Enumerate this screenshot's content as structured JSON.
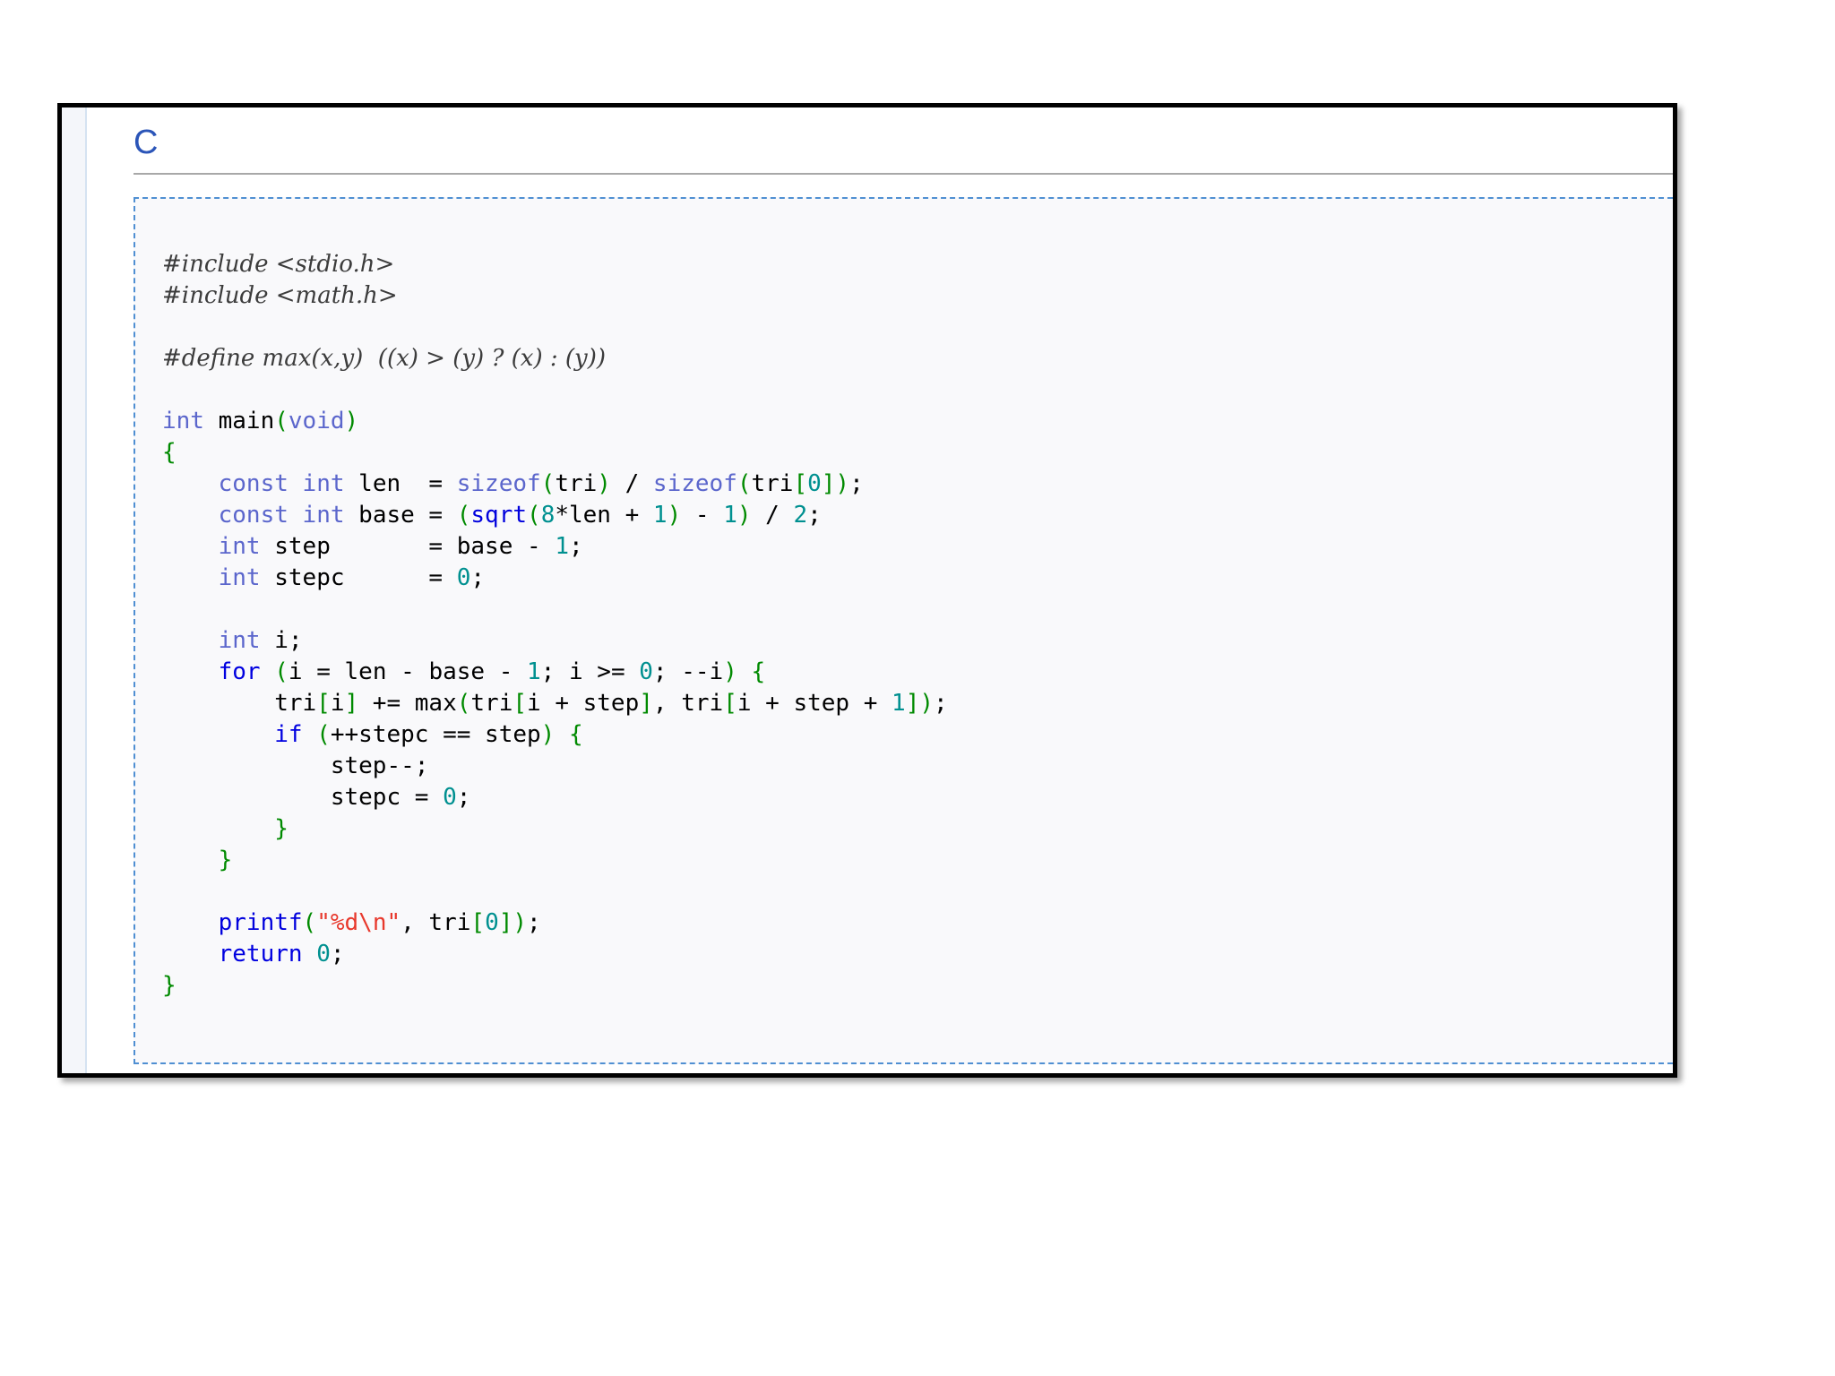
{
  "language_title": "C",
  "code_lines": [
    [
      {
        "t": "pre",
        "s": "#include <stdio.h>"
      }
    ],
    [
      {
        "t": "pre",
        "s": "#include <math.h>"
      }
    ],
    [],
    [
      {
        "t": "pre",
        "s": "#define max(x,y)  ((x) > (y) ? (x) : (y))"
      }
    ],
    [],
    [
      {
        "t": "kw",
        "s": "int"
      },
      {
        "t": "txt",
        "s": " main"
      },
      {
        "t": "br",
        "s": "("
      },
      {
        "t": "kw",
        "s": "void"
      },
      {
        "t": "br",
        "s": ")"
      }
    ],
    [
      {
        "t": "br",
        "s": "{"
      }
    ],
    [
      {
        "t": "txt",
        "s": "    "
      },
      {
        "t": "kw",
        "s": "const int"
      },
      {
        "t": "txt",
        "s": " len  = "
      },
      {
        "t": "kw",
        "s": "sizeof"
      },
      {
        "t": "br",
        "s": "("
      },
      {
        "t": "txt",
        "s": "tri"
      },
      {
        "t": "br",
        "s": ")"
      },
      {
        "t": "txt",
        "s": " / "
      },
      {
        "t": "kw",
        "s": "sizeof"
      },
      {
        "t": "br",
        "s": "("
      },
      {
        "t": "txt",
        "s": "tri"
      },
      {
        "t": "br",
        "s": "["
      },
      {
        "t": "num",
        "s": "0"
      },
      {
        "t": "br",
        "s": "])"
      },
      {
        "t": "txt",
        "s": ";"
      }
    ],
    [
      {
        "t": "txt",
        "s": "    "
      },
      {
        "t": "kw",
        "s": "const int"
      },
      {
        "t": "txt",
        "s": " base = "
      },
      {
        "t": "br",
        "s": "("
      },
      {
        "t": "fn",
        "s": "sqrt"
      },
      {
        "t": "br",
        "s": "("
      },
      {
        "t": "num",
        "s": "8"
      },
      {
        "t": "txt",
        "s": "*len + "
      },
      {
        "t": "num",
        "s": "1"
      },
      {
        "t": "br",
        "s": ")"
      },
      {
        "t": "txt",
        "s": " - "
      },
      {
        "t": "num",
        "s": "1"
      },
      {
        "t": "br",
        "s": ")"
      },
      {
        "t": "txt",
        "s": " / "
      },
      {
        "t": "num",
        "s": "2"
      },
      {
        "t": "txt",
        "s": ";"
      }
    ],
    [
      {
        "t": "txt",
        "s": "    "
      },
      {
        "t": "kw",
        "s": "int"
      },
      {
        "t": "txt",
        "s": " step       = base - "
      },
      {
        "t": "num",
        "s": "1"
      },
      {
        "t": "txt",
        "s": ";"
      }
    ],
    [
      {
        "t": "txt",
        "s": "    "
      },
      {
        "t": "kw",
        "s": "int"
      },
      {
        "t": "txt",
        "s": " stepc      = "
      },
      {
        "t": "num",
        "s": "0"
      },
      {
        "t": "txt",
        "s": ";"
      }
    ],
    [],
    [
      {
        "t": "txt",
        "s": "    "
      },
      {
        "t": "kw",
        "s": "int"
      },
      {
        "t": "txt",
        "s": " i;"
      }
    ],
    [
      {
        "t": "txt",
        "s": "    "
      },
      {
        "t": "kwb",
        "s": "for"
      },
      {
        "t": "txt",
        "s": " "
      },
      {
        "t": "br",
        "s": "("
      },
      {
        "t": "txt",
        "s": "i = len - base - "
      },
      {
        "t": "num",
        "s": "1"
      },
      {
        "t": "txt",
        "s": "; i >= "
      },
      {
        "t": "num",
        "s": "0"
      },
      {
        "t": "txt",
        "s": "; --i"
      },
      {
        "t": "br",
        "s": ")"
      },
      {
        "t": "txt",
        "s": " "
      },
      {
        "t": "br",
        "s": "{"
      }
    ],
    [
      {
        "t": "txt",
        "s": "        tri"
      },
      {
        "t": "br",
        "s": "["
      },
      {
        "t": "txt",
        "s": "i"
      },
      {
        "t": "br",
        "s": "]"
      },
      {
        "t": "txt",
        "s": " += max"
      },
      {
        "t": "br",
        "s": "("
      },
      {
        "t": "txt",
        "s": "tri"
      },
      {
        "t": "br",
        "s": "["
      },
      {
        "t": "txt",
        "s": "i + step"
      },
      {
        "t": "br",
        "s": "]"
      },
      {
        "t": "txt",
        "s": ", tri"
      },
      {
        "t": "br",
        "s": "["
      },
      {
        "t": "txt",
        "s": "i + step + "
      },
      {
        "t": "num",
        "s": "1"
      },
      {
        "t": "br",
        "s": "])"
      },
      {
        "t": "txt",
        "s": ";"
      }
    ],
    [
      {
        "t": "txt",
        "s": "        "
      },
      {
        "t": "kwb",
        "s": "if"
      },
      {
        "t": "txt",
        "s": " "
      },
      {
        "t": "br",
        "s": "("
      },
      {
        "t": "txt",
        "s": "++stepc == step"
      },
      {
        "t": "br",
        "s": ")"
      },
      {
        "t": "txt",
        "s": " "
      },
      {
        "t": "br",
        "s": "{"
      }
    ],
    [
      {
        "t": "txt",
        "s": "            step--;"
      }
    ],
    [
      {
        "t": "txt",
        "s": "            stepc = "
      },
      {
        "t": "num",
        "s": "0"
      },
      {
        "t": "txt",
        "s": ";"
      }
    ],
    [
      {
        "t": "txt",
        "s": "        "
      },
      {
        "t": "br",
        "s": "}"
      }
    ],
    [
      {
        "t": "txt",
        "s": "    "
      },
      {
        "t": "br",
        "s": "}"
      }
    ],
    [],
    [
      {
        "t": "txt",
        "s": "    "
      },
      {
        "t": "fn",
        "s": "printf"
      },
      {
        "t": "br",
        "s": "("
      },
      {
        "t": "str",
        "s": "\"%d\\n\""
      },
      {
        "t": "txt",
        "s": ", tri"
      },
      {
        "t": "br",
        "s": "["
      },
      {
        "t": "num",
        "s": "0"
      },
      {
        "t": "br",
        "s": "])"
      },
      {
        "t": "txt",
        "s": ";"
      }
    ],
    [
      {
        "t": "txt",
        "s": "    "
      },
      {
        "t": "kwb",
        "s": "return"
      },
      {
        "t": "txt",
        "s": " "
      },
      {
        "t": "num",
        "s": "0"
      },
      {
        "t": "txt",
        "s": ";"
      }
    ],
    [
      {
        "t": "br",
        "s": "}"
      }
    ]
  ],
  "colors": {
    "title": "#2b55b8",
    "keyword": "#5b66cc",
    "keyword_bold": "#0000e0",
    "function": "#0000dd",
    "number": "#009090",
    "bracket": "#008a00",
    "string": "#e8382c",
    "preprocessor": "#3c3c3c",
    "box_border": "#4f8fd2"
  }
}
